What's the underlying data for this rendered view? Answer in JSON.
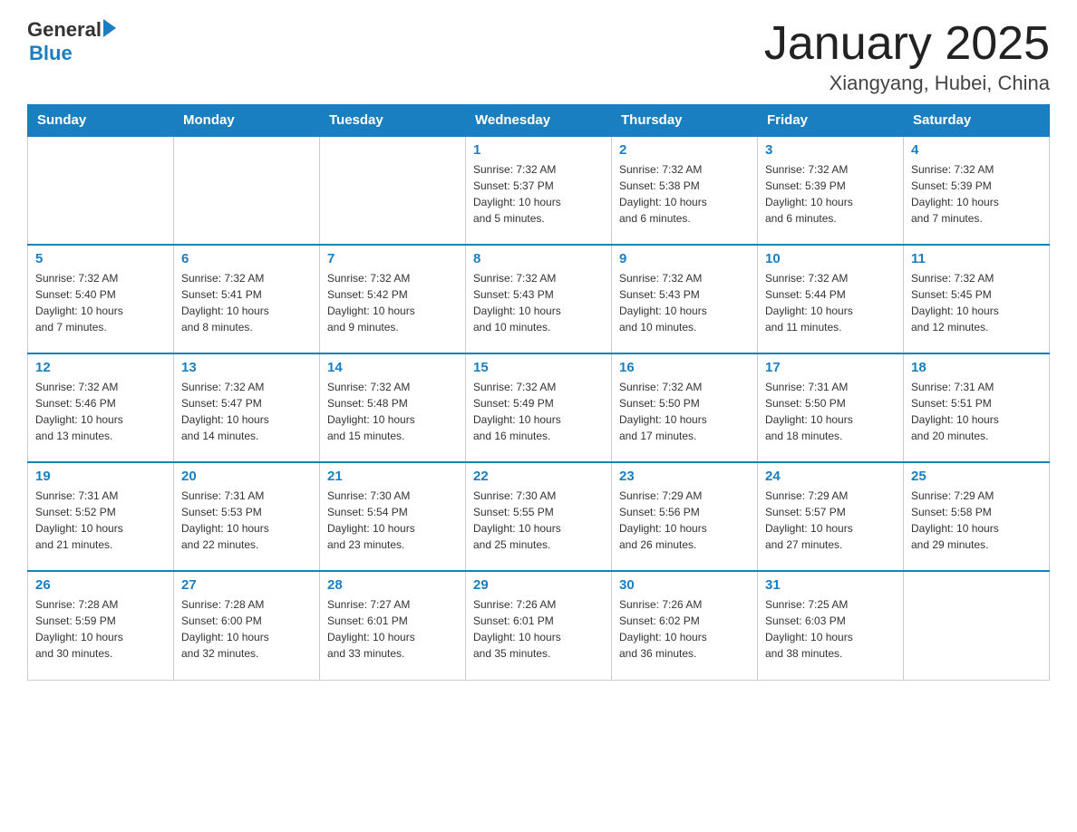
{
  "header": {
    "logo_text1": "General",
    "logo_text2": "Blue",
    "month_title": "January 2025",
    "location": "Xiangyang, Hubei, China"
  },
  "weekdays": [
    "Sunday",
    "Monday",
    "Tuesday",
    "Wednesday",
    "Thursday",
    "Friday",
    "Saturday"
  ],
  "weeks": [
    [
      {
        "day": "",
        "info": ""
      },
      {
        "day": "",
        "info": ""
      },
      {
        "day": "",
        "info": ""
      },
      {
        "day": "1",
        "info": "Sunrise: 7:32 AM\nSunset: 5:37 PM\nDaylight: 10 hours\nand 5 minutes."
      },
      {
        "day": "2",
        "info": "Sunrise: 7:32 AM\nSunset: 5:38 PM\nDaylight: 10 hours\nand 6 minutes."
      },
      {
        "day": "3",
        "info": "Sunrise: 7:32 AM\nSunset: 5:39 PM\nDaylight: 10 hours\nand 6 minutes."
      },
      {
        "day": "4",
        "info": "Sunrise: 7:32 AM\nSunset: 5:39 PM\nDaylight: 10 hours\nand 7 minutes."
      }
    ],
    [
      {
        "day": "5",
        "info": "Sunrise: 7:32 AM\nSunset: 5:40 PM\nDaylight: 10 hours\nand 7 minutes."
      },
      {
        "day": "6",
        "info": "Sunrise: 7:32 AM\nSunset: 5:41 PM\nDaylight: 10 hours\nand 8 minutes."
      },
      {
        "day": "7",
        "info": "Sunrise: 7:32 AM\nSunset: 5:42 PM\nDaylight: 10 hours\nand 9 minutes."
      },
      {
        "day": "8",
        "info": "Sunrise: 7:32 AM\nSunset: 5:43 PM\nDaylight: 10 hours\nand 10 minutes."
      },
      {
        "day": "9",
        "info": "Sunrise: 7:32 AM\nSunset: 5:43 PM\nDaylight: 10 hours\nand 10 minutes."
      },
      {
        "day": "10",
        "info": "Sunrise: 7:32 AM\nSunset: 5:44 PM\nDaylight: 10 hours\nand 11 minutes."
      },
      {
        "day": "11",
        "info": "Sunrise: 7:32 AM\nSunset: 5:45 PM\nDaylight: 10 hours\nand 12 minutes."
      }
    ],
    [
      {
        "day": "12",
        "info": "Sunrise: 7:32 AM\nSunset: 5:46 PM\nDaylight: 10 hours\nand 13 minutes."
      },
      {
        "day": "13",
        "info": "Sunrise: 7:32 AM\nSunset: 5:47 PM\nDaylight: 10 hours\nand 14 minutes."
      },
      {
        "day": "14",
        "info": "Sunrise: 7:32 AM\nSunset: 5:48 PM\nDaylight: 10 hours\nand 15 minutes."
      },
      {
        "day": "15",
        "info": "Sunrise: 7:32 AM\nSunset: 5:49 PM\nDaylight: 10 hours\nand 16 minutes."
      },
      {
        "day": "16",
        "info": "Sunrise: 7:32 AM\nSunset: 5:50 PM\nDaylight: 10 hours\nand 17 minutes."
      },
      {
        "day": "17",
        "info": "Sunrise: 7:31 AM\nSunset: 5:50 PM\nDaylight: 10 hours\nand 18 minutes."
      },
      {
        "day": "18",
        "info": "Sunrise: 7:31 AM\nSunset: 5:51 PM\nDaylight: 10 hours\nand 20 minutes."
      }
    ],
    [
      {
        "day": "19",
        "info": "Sunrise: 7:31 AM\nSunset: 5:52 PM\nDaylight: 10 hours\nand 21 minutes."
      },
      {
        "day": "20",
        "info": "Sunrise: 7:31 AM\nSunset: 5:53 PM\nDaylight: 10 hours\nand 22 minutes."
      },
      {
        "day": "21",
        "info": "Sunrise: 7:30 AM\nSunset: 5:54 PM\nDaylight: 10 hours\nand 23 minutes."
      },
      {
        "day": "22",
        "info": "Sunrise: 7:30 AM\nSunset: 5:55 PM\nDaylight: 10 hours\nand 25 minutes."
      },
      {
        "day": "23",
        "info": "Sunrise: 7:29 AM\nSunset: 5:56 PM\nDaylight: 10 hours\nand 26 minutes."
      },
      {
        "day": "24",
        "info": "Sunrise: 7:29 AM\nSunset: 5:57 PM\nDaylight: 10 hours\nand 27 minutes."
      },
      {
        "day": "25",
        "info": "Sunrise: 7:29 AM\nSunset: 5:58 PM\nDaylight: 10 hours\nand 29 minutes."
      }
    ],
    [
      {
        "day": "26",
        "info": "Sunrise: 7:28 AM\nSunset: 5:59 PM\nDaylight: 10 hours\nand 30 minutes."
      },
      {
        "day": "27",
        "info": "Sunrise: 7:28 AM\nSunset: 6:00 PM\nDaylight: 10 hours\nand 32 minutes."
      },
      {
        "day": "28",
        "info": "Sunrise: 7:27 AM\nSunset: 6:01 PM\nDaylight: 10 hours\nand 33 minutes."
      },
      {
        "day": "29",
        "info": "Sunrise: 7:26 AM\nSunset: 6:01 PM\nDaylight: 10 hours\nand 35 minutes."
      },
      {
        "day": "30",
        "info": "Sunrise: 7:26 AM\nSunset: 6:02 PM\nDaylight: 10 hours\nand 36 minutes."
      },
      {
        "day": "31",
        "info": "Sunrise: 7:25 AM\nSunset: 6:03 PM\nDaylight: 10 hours\nand 38 minutes."
      },
      {
        "day": "",
        "info": ""
      }
    ]
  ]
}
